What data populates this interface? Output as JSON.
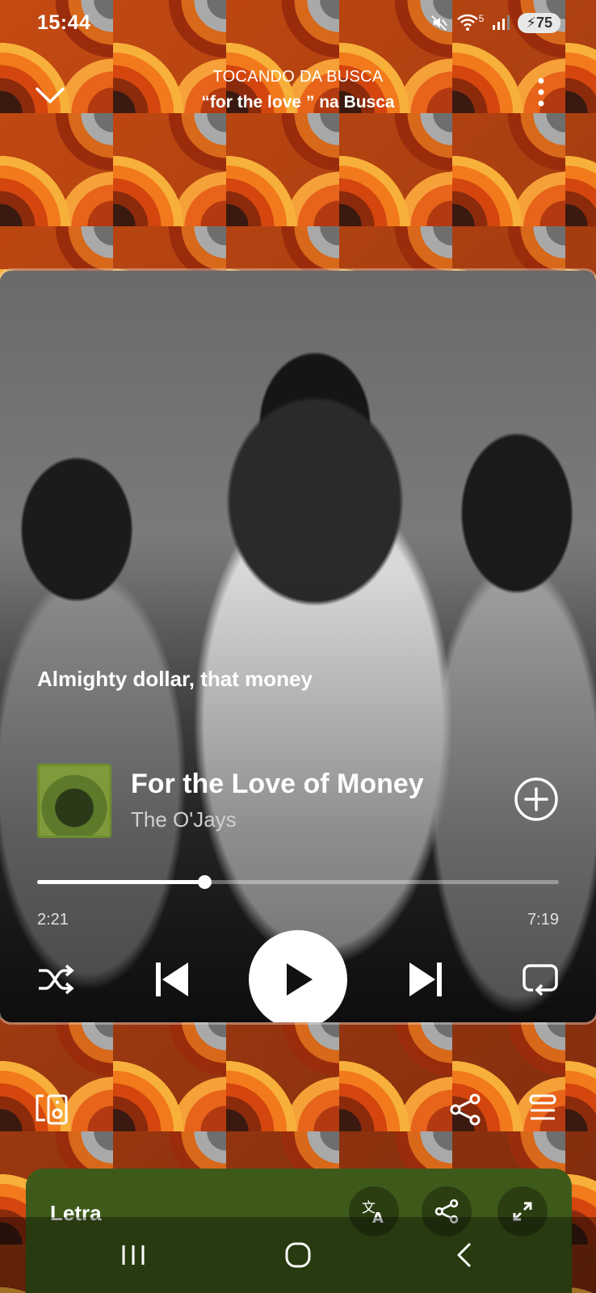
{
  "status_bar": {
    "time": "15:44",
    "wifi_badge": "5",
    "battery": "75"
  },
  "header": {
    "context_label": "TOCANDO DA BUSCA",
    "context_name": "“for the love ” na Busca"
  },
  "now_playing": {
    "lyric_line": "Almighty dollar, that money",
    "title": "For the Love of Money",
    "artist": "The O'Jays",
    "elapsed": "2:21",
    "total": "7:19",
    "progress_fraction": 0.32
  },
  "lyrics": {
    "title": "Letra"
  },
  "icons": {
    "collapse": "chevron-down-icon",
    "more": "more-vertical-icon",
    "add": "add-circle-icon",
    "shuffle": "shuffle-icon",
    "previous": "skip-previous-icon",
    "play": "play-icon",
    "next": "skip-next-icon",
    "repeat": "repeat-icon",
    "devices": "devices-icon",
    "share": "share-icon",
    "queue": "queue-icon",
    "translate": "translate-icon",
    "expand": "expand-icon"
  },
  "colors": {
    "lyrics_panel": "#3d5a1a",
    "accent": "#ffffff"
  }
}
